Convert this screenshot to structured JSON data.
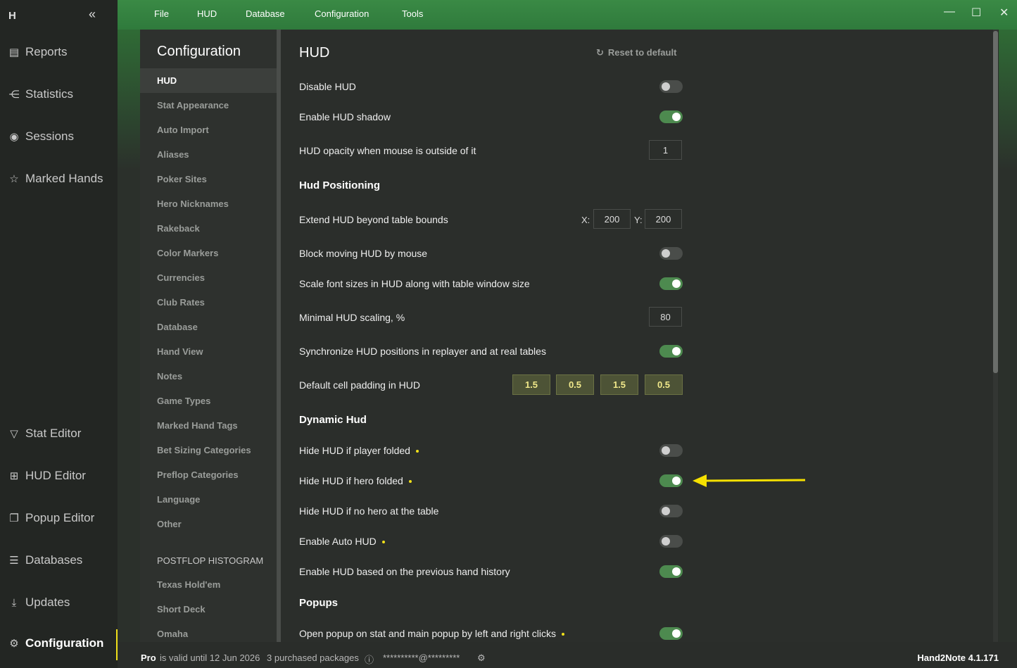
{
  "app": {
    "version": "Hand2Note 4.1.171"
  },
  "leftnav": {
    "logo": "H",
    "items": [
      {
        "label": "Reports",
        "icon": "report-icon"
      },
      {
        "label": "Statistics",
        "icon": "statistics-icon"
      },
      {
        "label": "Sessions",
        "icon": "sessions-icon"
      },
      {
        "label": "Marked Hands",
        "icon": "marked-hands-icon"
      },
      {
        "label": "Stat Editor",
        "icon": "filter-icon"
      },
      {
        "label": "HUD Editor",
        "icon": "hud-editor-icon"
      },
      {
        "label": "Popup Editor",
        "icon": "popup-editor-icon"
      },
      {
        "label": "Databases",
        "icon": "database-icon"
      },
      {
        "label": "Updates",
        "icon": "download-icon"
      },
      {
        "label": "Configuration",
        "icon": "gear-icon"
      }
    ]
  },
  "menu": [
    "File",
    "HUD",
    "Database",
    "Configuration",
    "Tools"
  ],
  "config": {
    "title": "Configuration",
    "items": [
      "HUD",
      "Stat Appearance",
      "Auto Import",
      "Aliases",
      "Poker Sites",
      "Hero Nicknames",
      "Rakeback",
      "Color Markers",
      "Currencies",
      "Club Rates",
      "Database",
      "Hand View",
      "Notes",
      "Game Types",
      "Marked Hand Tags",
      "Bet Sizing Categories",
      "Preflop Categories",
      "Language",
      "Other"
    ],
    "section2": "POSTFLOP HISTOGRAM",
    "items2": [
      "Texas Hold'em",
      "Short Deck",
      "Omaha"
    ]
  },
  "hud": {
    "title": "HUD",
    "reset": "Reset to default",
    "disable_hud": "Disable HUD",
    "enable_shadow": "Enable HUD shadow",
    "opacity_label": "HUD opacity when mouse is outside of it",
    "opacity_value": "1",
    "positioning": "Hud Positioning",
    "extend_label": "Extend HUD beyond table bounds",
    "x_label": "X:",
    "x_value": "200",
    "y_label": "Y:",
    "y_value": "200",
    "block_moving": "Block moving HUD by mouse",
    "scale_fonts": "Scale font sizes in HUD along with table window size",
    "min_scaling_label": "Minimal HUD scaling, %",
    "min_scaling_value": "80",
    "sync_positions": "Synchronize HUD positions in replayer and at real tables",
    "cell_padding_label": "Default cell padding in HUD",
    "cell_padding": [
      "1.5",
      "0.5",
      "1.5",
      "0.5"
    ],
    "dynamic": "Dynamic Hud",
    "hide_player_folded": "Hide HUD if player folded",
    "hide_hero_folded": "Hide HUD if hero folded",
    "hide_no_hero": "Hide HUD if no hero at the table",
    "enable_auto": "Enable Auto HUD",
    "enable_prev": "Enable HUD based on the previous hand history",
    "popups": "Popups",
    "open_popup": "Open popup on stat and main popup by left and right clicks"
  },
  "status": {
    "plan": "Pro",
    "valid": "is valid until 12 Jun 2026",
    "packages": "3 purchased packages",
    "email": "**********@*********"
  }
}
